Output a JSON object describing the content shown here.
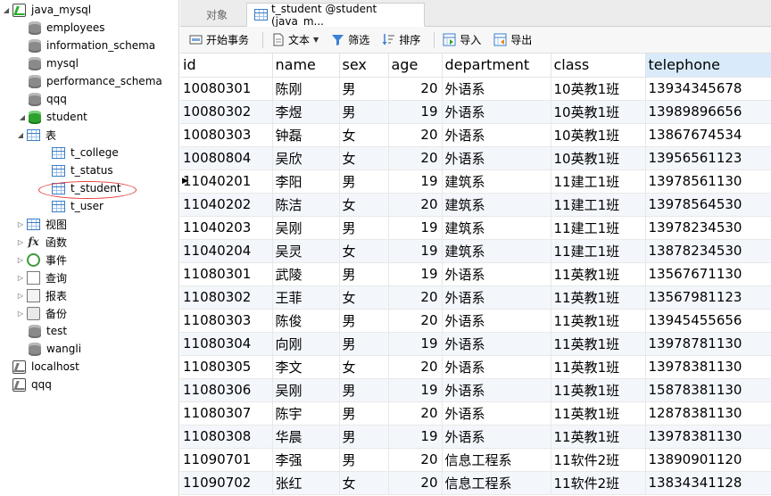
{
  "tree": {
    "items": [
      {
        "label": "java_mysql",
        "icon": "server-icon",
        "depth": 0,
        "expander": "expanded"
      },
      {
        "label": "employees",
        "icon": "database-icon",
        "depth": 1,
        "expander": ""
      },
      {
        "label": "information_schema",
        "icon": "database-icon",
        "depth": 1,
        "expander": ""
      },
      {
        "label": "mysql",
        "icon": "database-icon",
        "depth": 1,
        "expander": ""
      },
      {
        "label": "performance_schema",
        "icon": "database-icon",
        "depth": 1,
        "expander": ""
      },
      {
        "label": "qqq",
        "icon": "database-icon",
        "depth": 1,
        "expander": ""
      },
      {
        "label": "student",
        "icon": "database-open-icon",
        "depth": 1,
        "expander": "expanded"
      },
      {
        "label": "表",
        "icon": "tables-folder-icon",
        "depth": 2,
        "expander": "expanded"
      },
      {
        "label": "t_college",
        "icon": "table-icon",
        "depth": 3,
        "expander": ""
      },
      {
        "label": "t_status",
        "icon": "table-icon",
        "depth": 3,
        "expander": ""
      },
      {
        "label": "t_student",
        "icon": "table-icon",
        "depth": 3,
        "expander": ""
      },
      {
        "label": "t_user",
        "icon": "table-icon",
        "depth": 3,
        "expander": ""
      },
      {
        "label": "视图",
        "icon": "views-icon",
        "depth": 2,
        "expander": "collapsed"
      },
      {
        "label": "函数",
        "icon": "function-icon",
        "depth": 2,
        "expander": "collapsed"
      },
      {
        "label": "事件",
        "icon": "event-icon",
        "depth": 2,
        "expander": "collapsed"
      },
      {
        "label": "查询",
        "icon": "query-icon",
        "depth": 2,
        "expander": "collapsed"
      },
      {
        "label": "报表",
        "icon": "report-icon",
        "depth": 2,
        "expander": "collapsed"
      },
      {
        "label": "备份",
        "icon": "backup-icon",
        "depth": 2,
        "expander": "collapsed"
      },
      {
        "label": "test",
        "icon": "database-icon",
        "depth": 1,
        "expander": ""
      },
      {
        "label": "wangli",
        "icon": "database-icon",
        "depth": 1,
        "expander": ""
      },
      {
        "label": "localhost",
        "icon": "server-gray-icon",
        "depth": 0,
        "expander": ""
      },
      {
        "label": "qqq",
        "icon": "server-gray-icon",
        "depth": 0,
        "expander": ""
      }
    ]
  },
  "tabs": [
    {
      "label": "对象",
      "active": false
    },
    {
      "label": "t_student @student (java_m...",
      "active": true
    }
  ],
  "toolbar": {
    "begin_transaction": "开始事务",
    "text": "文本",
    "filter": "筛选",
    "sort": "排序",
    "import": "导入",
    "export": "导出"
  },
  "grid": {
    "columns": [
      "id",
      "name",
      "sex",
      "age",
      "department",
      "class",
      "telephone"
    ],
    "rows": [
      [
        "10080301",
        "陈刚",
        "男",
        "20",
        "外语系",
        "10英教1班",
        "13934345678"
      ],
      [
        "10080302",
        "李煜",
        "男",
        "19",
        "外语系",
        "10英教1班",
        "13989896656"
      ],
      [
        "10080303",
        "钟磊",
        "女",
        "20",
        "外语系",
        "10英教1班",
        "13867674534"
      ],
      [
        "10080804",
        "吴欣",
        "女",
        "20",
        "外语系",
        "10英教1班",
        "13956561123"
      ],
      [
        "11040201",
        "李阳",
        "男",
        "19",
        "建筑系",
        "11建工1班",
        "13978561130"
      ],
      [
        "11040202",
        "陈洁",
        "女",
        "20",
        "建筑系",
        "11建工1班",
        "13978564530"
      ],
      [
        "11040203",
        "吴刚",
        "男",
        "19",
        "建筑系",
        "11建工1班",
        "13978234530"
      ],
      [
        "11040204",
        "吴灵",
        "女",
        "19",
        "建筑系",
        "11建工1班",
        "13878234530"
      ],
      [
        "11080301",
        "武陵",
        "男",
        "19",
        "外语系",
        "11英教1班",
        "13567671130"
      ],
      [
        "11080302",
        "王菲",
        "女",
        "20",
        "外语系",
        "11英教1班",
        "13567981123"
      ],
      [
        "11080303",
        "陈俊",
        "男",
        "20",
        "外语系",
        "11英教1班",
        "13945455656"
      ],
      [
        "11080304",
        "向刚",
        "男",
        "19",
        "外语系",
        "11英教1班",
        "13978781130"
      ],
      [
        "11080305",
        "李文",
        "女",
        "20",
        "外语系",
        "11英教1班",
        "13978381130"
      ],
      [
        "11080306",
        "吴刚",
        "男",
        "19",
        "外语系",
        "11英教1班",
        "15878381130"
      ],
      [
        "11080307",
        "陈宇",
        "男",
        "20",
        "外语系",
        "11英教1班",
        "12878381130"
      ],
      [
        "11080308",
        "华晨",
        "男",
        "19",
        "外语系",
        "11英教1班",
        "13978381130"
      ],
      [
        "11090701",
        "李强",
        "男",
        "20",
        "信息工程系",
        "11软件2班",
        "13890901120"
      ],
      [
        "11090702",
        "张红",
        "女",
        "20",
        "信息工程系",
        "11软件2班",
        "13834341128"
      ]
    ],
    "current_row": 4,
    "highlighted_column": "telephone"
  }
}
